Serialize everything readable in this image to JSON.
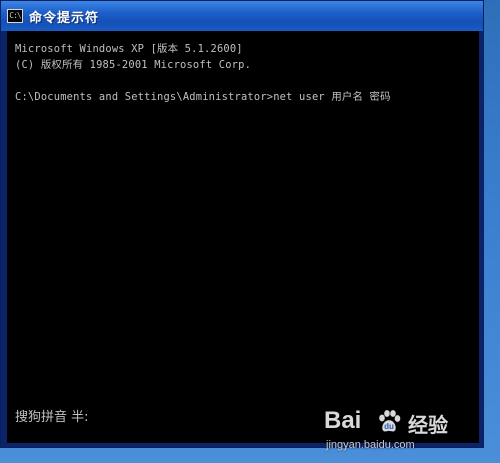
{
  "window": {
    "title": "命令提示符",
    "icon_label": "C:\\",
    "icon": "command-prompt-icon"
  },
  "console": {
    "lines": [
      "Microsoft Windows XP [版本 5.1.2600]",
      "(C) 版权所有 1985-2001 Microsoft Corp.",
      "",
      "C:\\Documents and Settings\\Administrator>net user 用户名 密码"
    ]
  },
  "ime": {
    "status": "搜狗拼音 半:"
  },
  "watermark": {
    "brand": "Bai",
    "brand_suffix": "经验",
    "url": "jingyan.baidu.com"
  },
  "colors": {
    "titlebar": "#1d5ec8",
    "console_bg": "#000000",
    "console_text": "#c0c0c0",
    "desktop": "#3a7fcf"
  }
}
